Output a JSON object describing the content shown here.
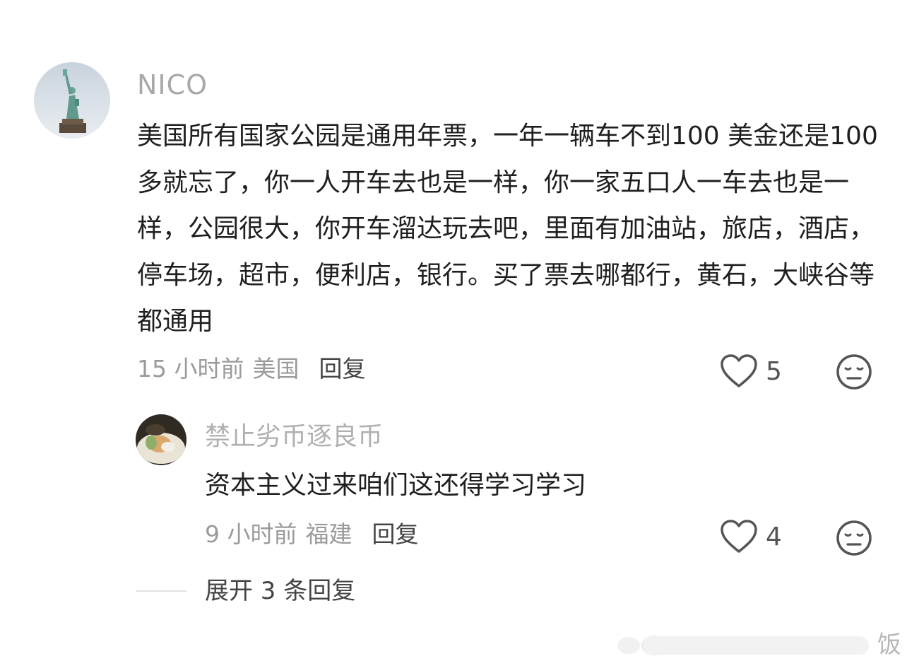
{
  "comment": {
    "username": "NICO",
    "text": "美国所有国家公园是通用年票，一年一辆车不到100 美金还是100 多就忘了，你一人开车去也是一样，你一家五口人一车去也是一样，公园很大，你开车溜达玩去吧，里面有加油站，旅店，酒店，停车场，超市，便利店，银行。买了票去哪都行，黄石，大峡谷等都通用",
    "time": "15 小时前",
    "location": "美国",
    "reply_label": "回复",
    "likes": "5",
    "avatar_icon": "statue-of-liberty-avatar",
    "like_icon": "heart-outline-icon",
    "emoji_icon": "meh-face-icon"
  },
  "sub_comment": {
    "username": "禁止劣币逐良币",
    "text": "资本主义过来咱们这还得学习学习",
    "time": "9 小时前",
    "location": "福建",
    "reply_label": "回复",
    "likes": "4",
    "avatar_icon": "food-photo-avatar",
    "like_icon": "heart-outline-icon",
    "emoji_icon": "meh-face-icon"
  },
  "expand": {
    "label": "展开 3 条回复"
  },
  "watermark": {
    "text": "饭"
  },
  "colors": {
    "username": "#a8a8a8",
    "body_text": "#1f1f1f",
    "meta_text": "#9b9b9b",
    "reply_link": "#444444",
    "background": "#ffffff"
  }
}
